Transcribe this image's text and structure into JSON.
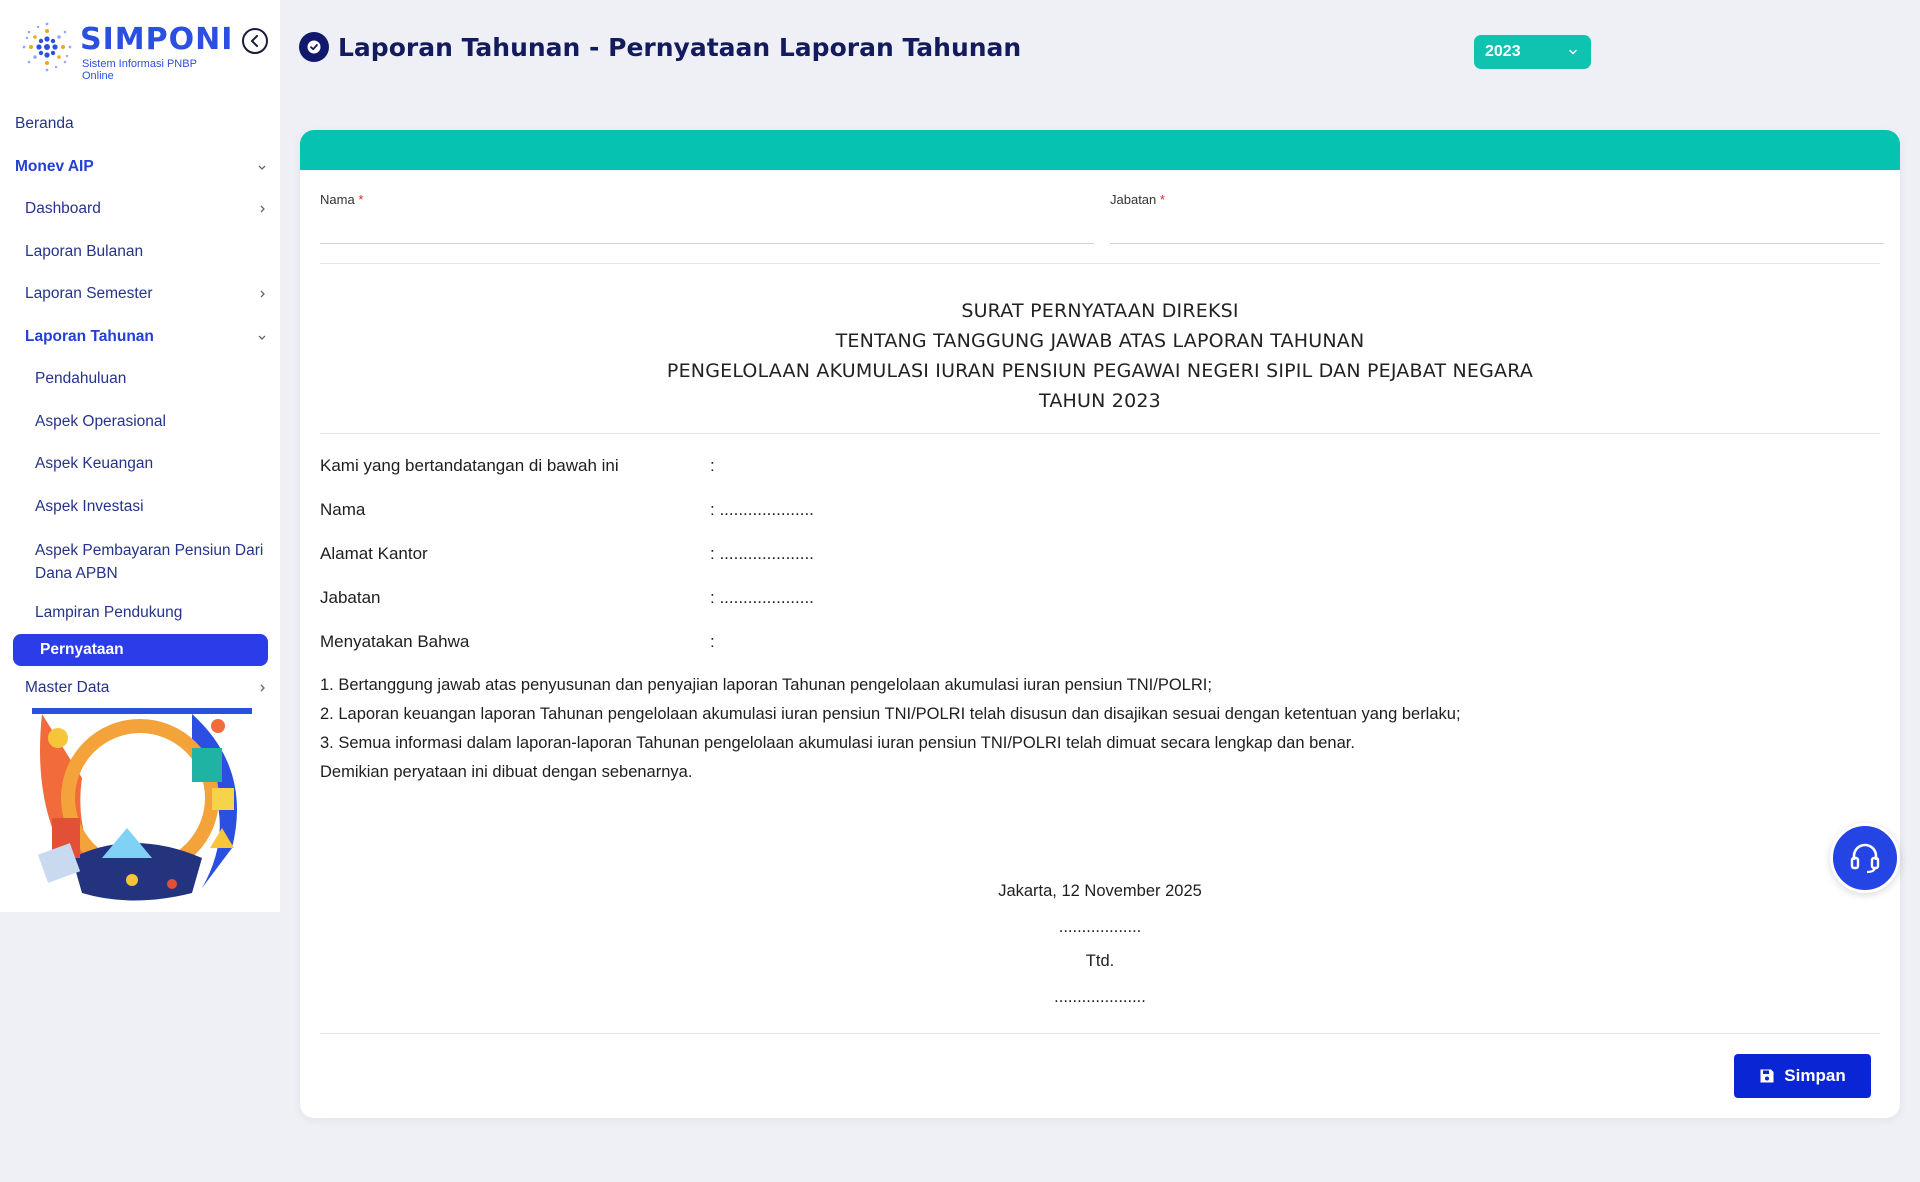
{
  "app": {
    "name": "SIMPONI",
    "subtitle": "Sistem Informasi PNBP Online"
  },
  "sidebar": {
    "items": [
      {
        "label": "Beranda"
      },
      {
        "label": "Monev AIP"
      },
      {
        "label": "Dashboard"
      },
      {
        "label": "Laporan Bulanan"
      },
      {
        "label": "Laporan Semester"
      },
      {
        "label": "Laporan Tahunan"
      },
      {
        "label": "Pendahuluan"
      },
      {
        "label": "Aspek Operasional"
      },
      {
        "label": "Aspek Keuangan"
      },
      {
        "label": "Aspek Investasi"
      },
      {
        "label": "Aspek Pembayaran Pensiun Dari Dana APBN"
      },
      {
        "label": "Lampiran Pendukung"
      },
      {
        "label": "Pernyataan"
      },
      {
        "label": "Master Data"
      }
    ]
  },
  "header": {
    "title": "Laporan Tahunan - Pernyataan Laporan Tahunan",
    "year_selected": "2023"
  },
  "form": {
    "nama_label": "Nama",
    "jabatan_label": "Jabatan",
    "required_mark": "*",
    "nama_value": "",
    "jabatan_value": ""
  },
  "document": {
    "title_lines": [
      "SURAT PERNYATAAN DIREKSI",
      "TENTANG TANGGUNG JAWAB ATAS LAPORAN TAHUNAN",
      "PENGELOLAAN AKUMULASI IURAN PENSIUN PEGAWAI NEGERI SIPIL DAN PEJABAT NEGARA",
      "TAHUN 2023"
    ],
    "rows": [
      {
        "label": "Kami yang bertandatangan di bawah ini",
        "value": ":"
      },
      {
        "label": "Nama",
        "value": ": ...................."
      },
      {
        "label": "Alamat Kantor",
        "value": ": ...................."
      },
      {
        "label": "Jabatan",
        "value": ": ...................."
      },
      {
        "label": "Menyatakan Bahwa",
        "value": ":"
      }
    ],
    "statements": [
      "1. Bertanggung jawab atas penyusunan dan penyajian laporan Tahunan pengelolaan akumulasi iuran pensiun TNI/POLRI;",
      "2. Laporan keuangan laporan Tahunan pengelolaan akumulasi iuran pensiun TNI/POLRI telah disusun dan disajikan sesuai dengan ketentuan yang berlaku;",
      "3. Semua informasi dalam laporan-laporan Tahunan pengelolaan akumulasi iuran pensiun TNI/POLRI telah dimuat secara lengkap dan benar.",
      "Demikian peryataan ini dibuat dengan sebenarnya."
    ],
    "place_date": "Jakarta, 12 November 2025",
    "dots_1": "..................",
    "ttd": "Ttd.",
    "dots_2": "...................."
  },
  "actions": {
    "save_label": "Simpan"
  },
  "icons": {
    "collapse": "chevron-left-circle-icon",
    "title": "check-circle-icon",
    "save": "floppy-disk-icon",
    "help": "headset-icon"
  },
  "colors": {
    "primary": "#2b3de8",
    "teal": "#05c2b1",
    "navy": "#131b5c",
    "save_button": "#0a25d3",
    "required": "#e0282b"
  }
}
